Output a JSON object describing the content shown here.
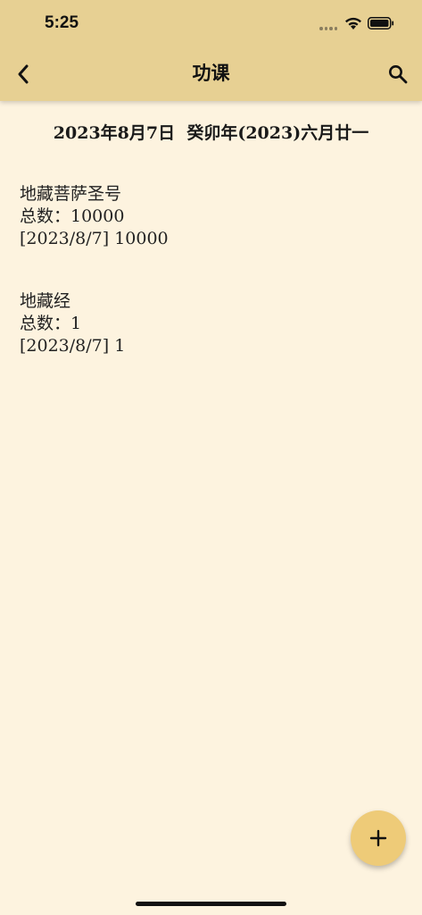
{
  "status_bar": {
    "time": "5:25"
  },
  "header": {
    "title": "功课",
    "back_icon": "chevron-left-icon",
    "search_icon": "search-icon"
  },
  "date_line": "2023年8月7日  癸卯年(2023)六月廿一",
  "entries": [
    {
      "name": "地藏菩萨圣号",
      "total": "总数：10000",
      "record": "[2023/8/7] 10000"
    },
    {
      "name": "地藏经",
      "total": "总数：1",
      "record": "[2023/8/7] 1"
    }
  ],
  "fab": {
    "icon": "plus-icon"
  },
  "colors": {
    "appbar": "#e7d093",
    "background": "#fdf3df",
    "fab": "#eecb78"
  }
}
